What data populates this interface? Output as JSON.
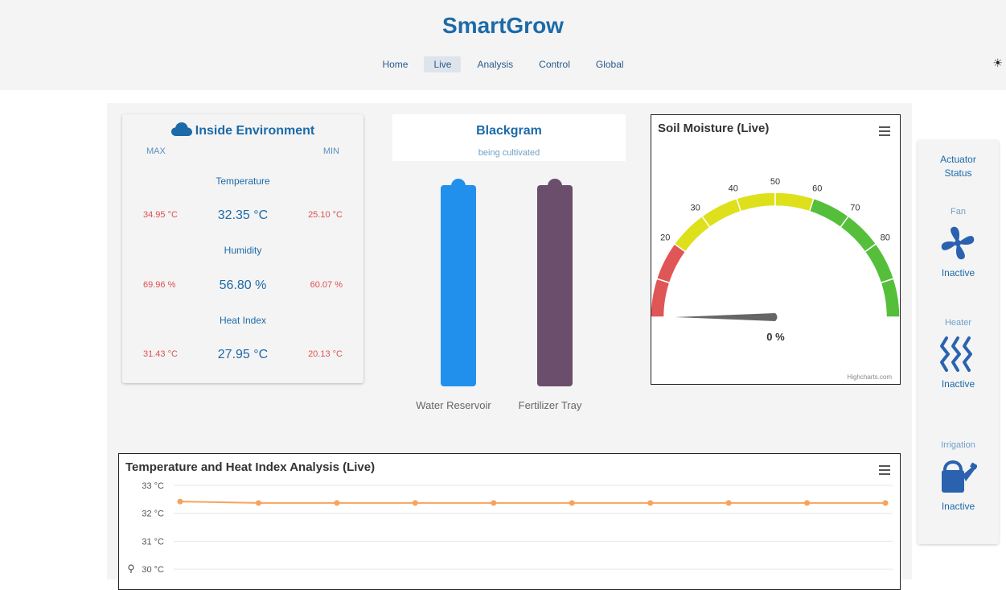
{
  "app": {
    "title": "SmartGrow"
  },
  "nav": {
    "items": [
      "Home",
      "Live",
      "Analysis",
      "Control",
      "Global"
    ],
    "active": "Live"
  },
  "environment": {
    "title": "Inside Environment",
    "max_label": "MAX",
    "min_label": "MIN",
    "metrics": [
      {
        "name": "Temperature",
        "max": "34.95 °C",
        "current": "32.35 °C",
        "min": "25.10 °C"
      },
      {
        "name": "Humidity",
        "max": "69.96 %",
        "current": "56.80 %",
        "min": "60.07 %"
      },
      {
        "name": "Heat Index",
        "max": "31.43 °C",
        "current": "27.95 °C",
        "min": "20.13 °C"
      }
    ]
  },
  "crop": {
    "name": "Blackgram",
    "subtitle": "being cultivated"
  },
  "tanks": {
    "water": {
      "label": "Water Reservoir",
      "color": "#2190ed"
    },
    "fertilizer": {
      "label": "Fertilizer Tray",
      "color": "#6b4e6b"
    }
  },
  "soil_gauge": {
    "title": "Soil Moisture (Live)",
    "value_label": "0 %",
    "value": 0,
    "ticks": [
      "20",
      "30",
      "40",
      "50",
      "60",
      "70",
      "80"
    ],
    "credits": "Highcharts.com",
    "colors": {
      "low": "#e05555",
      "mid": "#dde01a",
      "high": "#55bf3b",
      "needle": "#666666"
    }
  },
  "actuators": {
    "title": "Actuator Status",
    "items": [
      {
        "name": "Fan",
        "icon": "fan-icon",
        "state": "Inactive"
      },
      {
        "name": "Heater",
        "icon": "heater-icon",
        "state": "Inactive"
      },
      {
        "name": "Irrigation",
        "icon": "watering-can-icon",
        "state": "Inactive"
      }
    ]
  },
  "chart_data": {
    "type": "line",
    "title": "Temperature and Heat Index Analysis (Live)",
    "ylim": [
      30,
      33
    ],
    "yticks": [
      "33 °C",
      "32 °C",
      "31 °C",
      "30 °C"
    ],
    "series": [
      {
        "values": [
          32.42,
          32.37,
          32.37,
          32.37,
          32.37,
          32.37,
          32.37,
          32.37,
          32.37,
          32.37
        ],
        "color": "#f7a35c"
      }
    ],
    "grid": true
  }
}
